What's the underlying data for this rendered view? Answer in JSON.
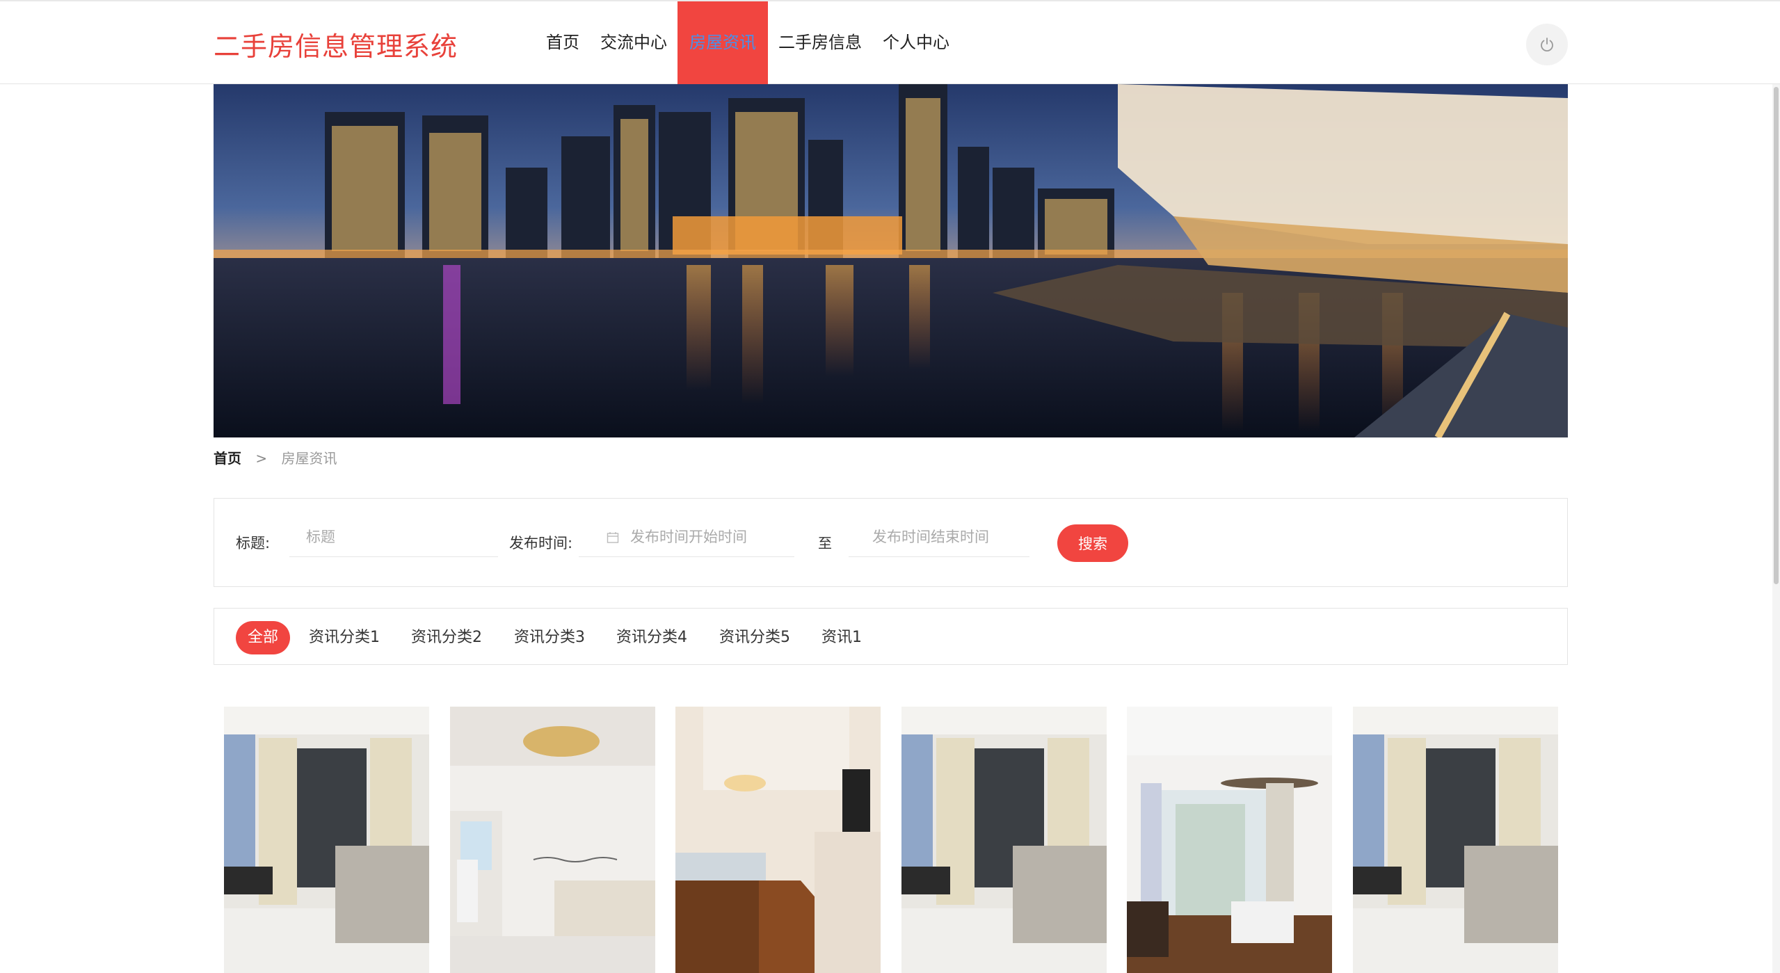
{
  "app": {
    "title": "二手房信息管理系统"
  },
  "colors": {
    "accent": "#f14540",
    "active_nav_text": "#4a8fe8",
    "logo": "#e8413a"
  },
  "nav": {
    "items": [
      {
        "label": "首页"
      },
      {
        "label": "交流中心"
      },
      {
        "label": "房屋资讯",
        "active": true
      },
      {
        "label": "二手房信息"
      },
      {
        "label": "个人中心"
      }
    ],
    "power_icon": "power-icon"
  },
  "breadcrumb": {
    "home": "首页",
    "separator": ">",
    "current": "房屋资讯"
  },
  "search": {
    "title_label": "标题:",
    "title_placeholder": "标题",
    "time_label": "发布时间:",
    "start_placeholder": "发布时间开始时间",
    "to_label": "至",
    "end_placeholder": "发布时间结束时间",
    "button_label": "搜索",
    "calendar_icon": "calendar-icon"
  },
  "categories": [
    {
      "label": "全部",
      "active": true
    },
    {
      "label": "资讯分类1"
    },
    {
      "label": "资讯分类2"
    },
    {
      "label": "资讯分类3"
    },
    {
      "label": "资讯分类4"
    },
    {
      "label": "资讯分类5"
    },
    {
      "label": "资讯1"
    }
  ],
  "news_cards": [
    {
      "image": "living-room-photo"
    },
    {
      "image": "living-room-chandelier-photo"
    },
    {
      "image": "hallway-photo"
    },
    {
      "image": "living-room-photo"
    },
    {
      "image": "living-room-fan-photo"
    },
    {
      "image": "living-room-photo"
    }
  ]
}
